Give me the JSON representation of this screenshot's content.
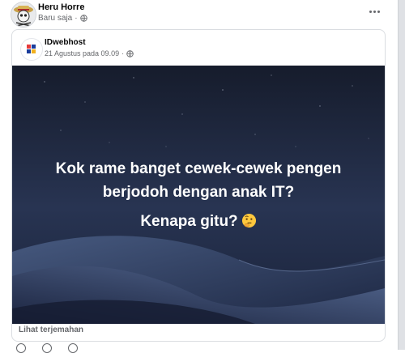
{
  "post": {
    "author": "Heru Horre",
    "timestamp": "Baru saja",
    "audience_icon": "globe-icon",
    "more_icon": "more-options-icon"
  },
  "shared_post": {
    "author": "IDwebhost",
    "timestamp": "21 Agustus pada 09.09",
    "audience_icon": "globe-icon",
    "image_text": {
      "line1": "Kok rame banget cewek-cewek pengen",
      "line2": "berjodoh dengan anak IT?",
      "line3": "Kenapa gitu?",
      "emoji": "thinking-face-icon"
    },
    "translate_label": "Lihat terjemahan"
  },
  "colors": {
    "text_primary": "#050505",
    "text_secondary": "#65676b",
    "image_bg": "#1b2336",
    "brand_blue": "#1a3c9c",
    "brand_red": "#e63a3a"
  }
}
